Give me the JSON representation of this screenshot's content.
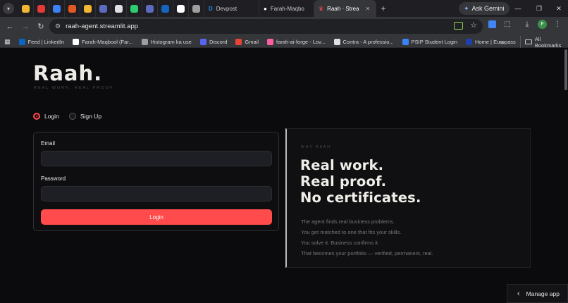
{
  "browser": {
    "tabs": [
      {
        "label": "Devpost",
        "favicon_color": "#1e88e5",
        "glyph": "D"
      },
      {
        "label": "Farah-Maqbo",
        "favicon_color": "#ffffff",
        "glyph": "●"
      },
      {
        "label": "Raah · Strea",
        "favicon_color": "#ff4b4b",
        "glyph": "♛",
        "active": true
      }
    ],
    "pinned_favicons": [
      "#f2b632",
      "#e53935",
      "#3b82f6",
      "#e25822",
      "#f2b632",
      "#5c6bc0",
      "#e0e0e0",
      "#2ecc71",
      "#5c6bc0",
      "#1565c0",
      "#ffffff",
      "#9e9e9e"
    ],
    "new_tab": "+",
    "gemini_label": "Ask Gemini",
    "url": "raah-agent.streamlit.app",
    "avatar_letter": "F",
    "bookmarks": [
      {
        "label": "Feed | LinkedIn",
        "color": "#0a66c2"
      },
      {
        "label": "Farah-Maqbool (Far...",
        "color": "#ffffff"
      },
      {
        "label": "Histogram ka use",
        "color": "#9e9e9e"
      },
      {
        "label": "Discord",
        "color": "#5865f2"
      },
      {
        "label": "Gmail",
        "color": "#ea4335"
      },
      {
        "label": "farah-ai-forge - Lov...",
        "color": "#ff5fa2"
      },
      {
        "label": "Contra - A professio...",
        "color": "#e0e0e0"
      },
      {
        "label": "PSIP Student Login",
        "color": "#3b82f6"
      },
      {
        "label": "Home | Europass",
        "color": "#1e40af"
      }
    ],
    "bookmarks_more": "»",
    "all_bookmarks": "All Bookmarks"
  },
  "app": {
    "logo": "Raah.",
    "tagline": "REAL WORK. REAL PROOF.",
    "auth_options": [
      {
        "label": "Login",
        "selected": true
      },
      {
        "label": "Sign Up",
        "selected": false
      }
    ],
    "form": {
      "email_label": "Email",
      "email_value": "",
      "password_label": "Password",
      "password_value": "",
      "submit_label": "Login"
    },
    "why": {
      "label": "WHY RAAH",
      "headline": [
        "Real work.",
        "Real proof.",
        "No certificates."
      ],
      "lines": [
        "The agent finds real business problems.",
        "You get matched to one that fits your skills.",
        "You solve it. Business confirms it.",
        "That becomes your portfolio — verified, permanent, real."
      ]
    },
    "manage_app": "Manage app"
  }
}
